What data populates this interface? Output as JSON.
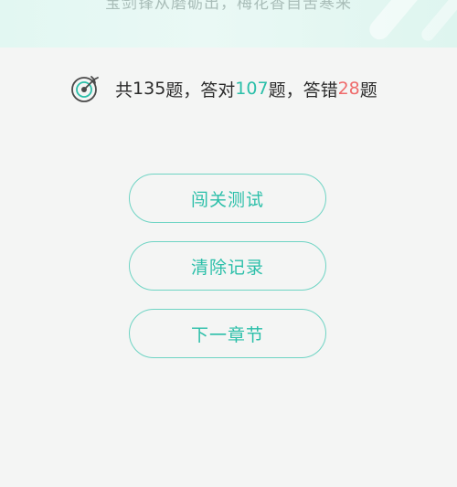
{
  "banner": {
    "quote": "宝剑锋从磨砺出，梅花香自苦寒来"
  },
  "stats": {
    "prefix": "共",
    "total": "135",
    "total_unit": "题，答对",
    "correct": "107",
    "correct_unit": "题，答错",
    "wrong": "28",
    "wrong_unit": "题",
    "icon": "target-icon"
  },
  "actions": {
    "challenge_label": "闯关测试",
    "clear_label": "清除记录",
    "next_label": "下一章节"
  },
  "colors": {
    "accent": "#2bbfa9",
    "error": "#ef6b6b",
    "background": "#f4f5f4"
  }
}
